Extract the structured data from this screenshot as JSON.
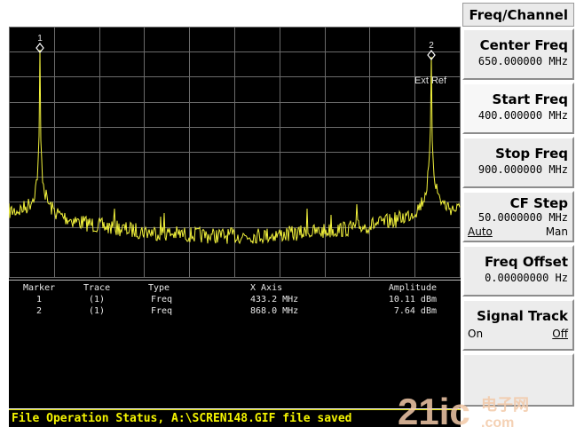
{
  "softkeys": {
    "menu_title": "Freq/Channel",
    "center_freq": {
      "label": "Center Freq",
      "value": "650.000000 MHz"
    },
    "start_freq": {
      "label": "Start Freq",
      "value": "400.000000 MHz"
    },
    "stop_freq": {
      "label": "Stop Freq",
      "value": "900.000000 MHz"
    },
    "cf_step": {
      "label": "CF Step",
      "value": "50.0000000 MHz",
      "opt_auto": "Auto",
      "opt_man": "Man"
    },
    "freq_offset": {
      "label": "Freq Offset",
      "value": "0.00000000  Hz"
    },
    "signal_track": {
      "label": "Signal Track",
      "opt_on": "On",
      "opt_off": "Off"
    }
  },
  "plot": {
    "trace_color": "#f2f23c",
    "marker1_label": "1",
    "marker2_label": "2",
    "ext_ref": "Ext Ref"
  },
  "marker_table": {
    "headers": [
      "Marker",
      "Trace",
      "Type",
      "X Axis",
      "Amplitude"
    ],
    "rows": [
      [
        "1",
        "(1)",
        "Freq",
        "433.2 MHz",
        "10.11 dBm"
      ],
      [
        "2",
        "(1)",
        "Freq",
        "868.0 MHz",
        "7.64 dBm"
      ]
    ]
  },
  "status": {
    "text": "File Operation Status, A:\\SCREN148.GIF file saved"
  },
  "watermark": {
    "text": "21ic.com",
    "cn": "电子网"
  }
}
